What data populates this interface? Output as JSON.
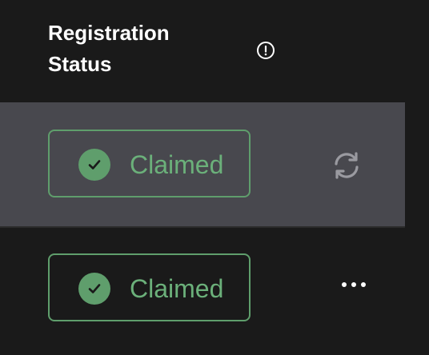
{
  "header": {
    "title_line1": "Registration",
    "title_line2": "Status",
    "info_icon": "info-circle-icon"
  },
  "rows": [
    {
      "status_label": "Claimed",
      "status_icon": "check-circle-icon",
      "action_icon": "refresh-icon",
      "highlighted": true
    },
    {
      "status_label": "Claimed",
      "status_icon": "check-circle-icon",
      "action_icon": "more-horizontal-icon",
      "highlighted": false
    }
  ],
  "colors": {
    "background": "#1a1a1a",
    "highlight_row": "#48484e",
    "success_green": "#5f9e6c",
    "success_text": "#6bb07a",
    "header_text": "#ffffff"
  }
}
